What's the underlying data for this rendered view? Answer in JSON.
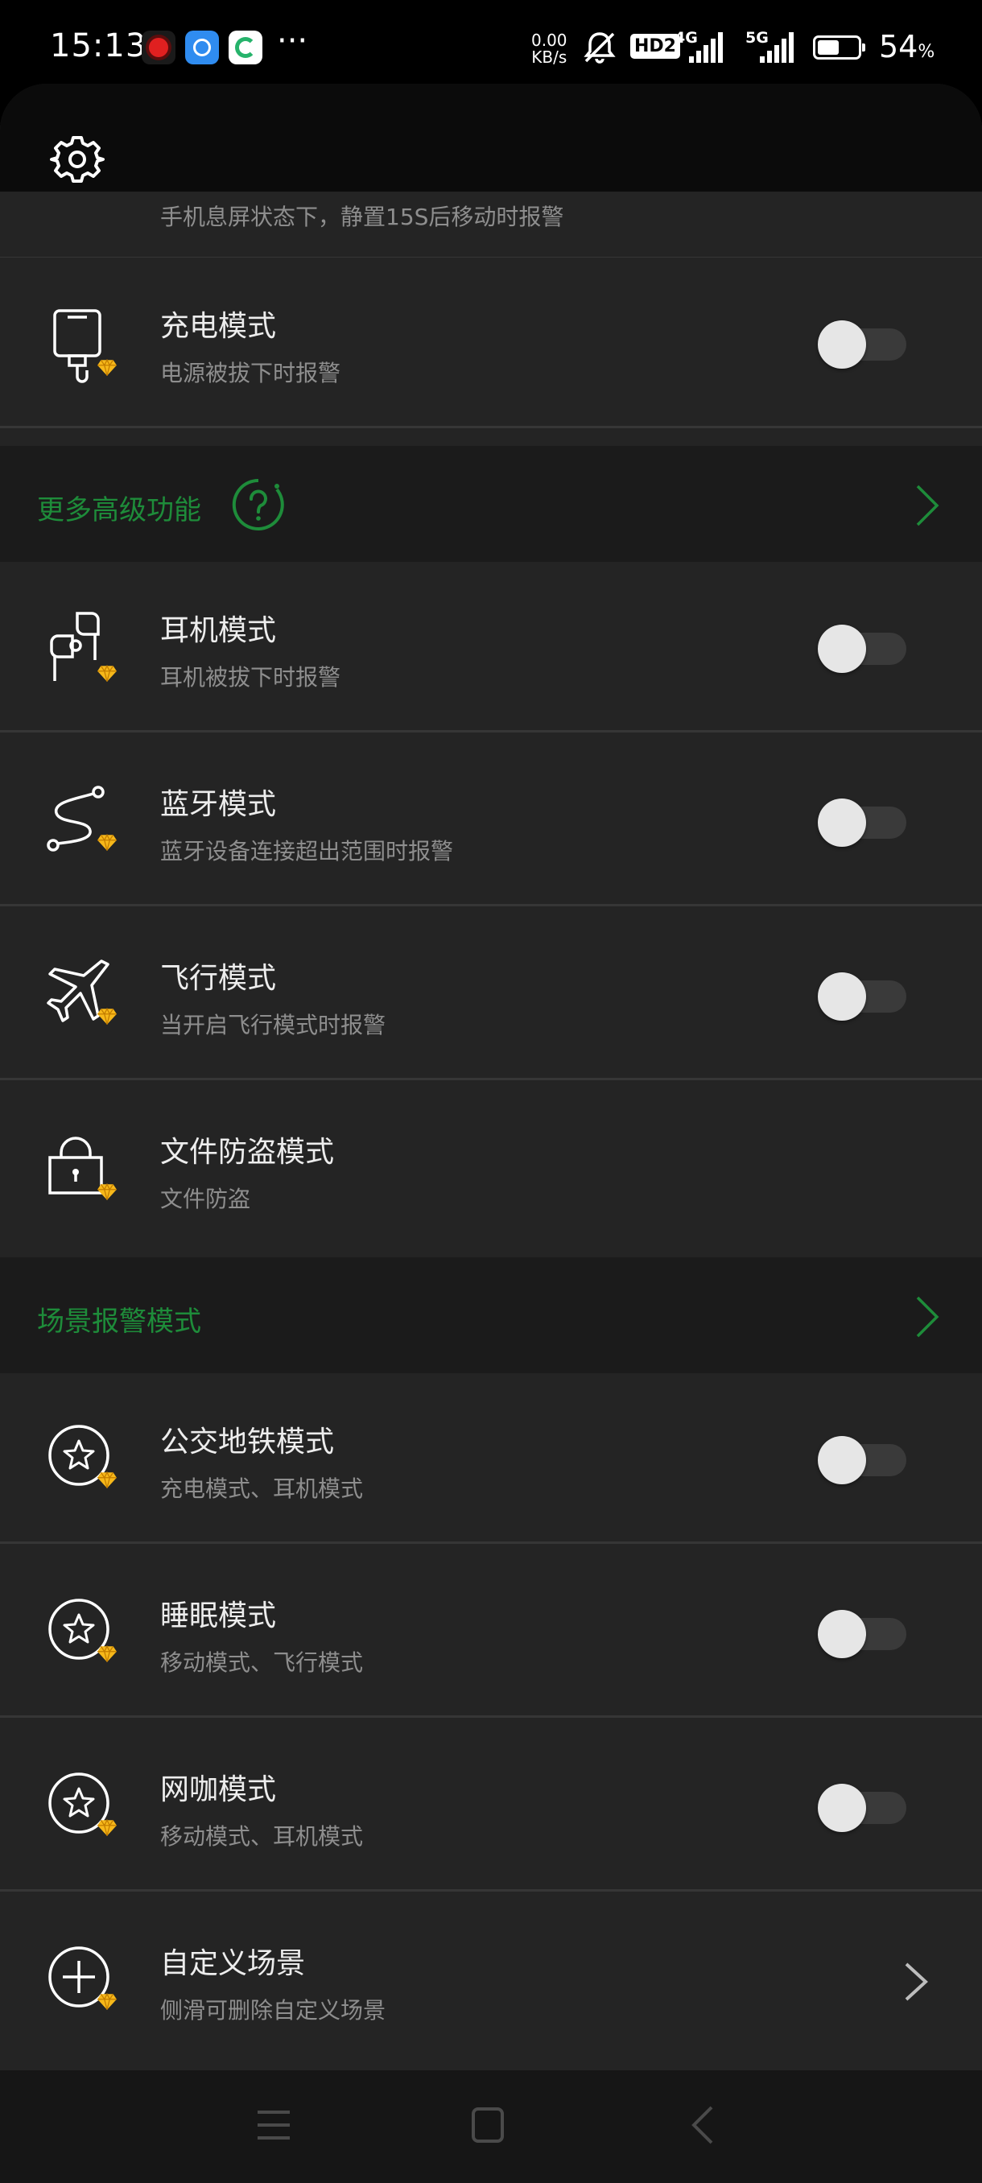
{
  "status_bar": {
    "time": "15:13",
    "speed_value": "0.00",
    "speed_unit": "KB/s",
    "hd_badge": "HD2",
    "net1": "4G",
    "net2": "5G",
    "battery_percent": 54,
    "battery_text": "54",
    "battery_unit": "%",
    "more_dots": "···"
  },
  "colors": {
    "accent_green": "#1e8c3a",
    "background": "#242424",
    "section_background": "#1b1b1b"
  },
  "top_partial": {
    "subtitle": "手机息屏状态下，静置15S后移动时报警",
    "toggle_on": false
  },
  "rows_basic": [
    {
      "title": "充电模式",
      "subtitle": "电源被拔下时报警",
      "icon": "charger-icon",
      "toggle_on": false
    }
  ],
  "section_advanced": {
    "label": "更多高级功能",
    "help_icon": "help-icon"
  },
  "rows_advanced": [
    {
      "title": "耳机模式",
      "subtitle": "耳机被拔下时报警",
      "icon": "earphones-icon",
      "toggle_on": false
    },
    {
      "title": "蓝牙模式",
      "subtitle": "蓝牙设备连接超出范围时报警",
      "icon": "bluetooth-route-icon",
      "toggle_on": false
    },
    {
      "title": "飞行模式",
      "subtitle": "当开启飞行模式时报警",
      "icon": "airplane-icon",
      "toggle_on": false
    },
    {
      "title": "文件防盗模式",
      "subtitle": "文件防盗",
      "icon": "lock-icon"
    }
  ],
  "section_scene": {
    "label": "场景报警模式"
  },
  "rows_scene": [
    {
      "title": "公交地铁模式",
      "subtitle": "充电模式、耳机模式",
      "icon": "star-icon",
      "toggle_on": false
    },
    {
      "title": "睡眠模式",
      "subtitle": "移动模式、飞行模式",
      "icon": "star-icon",
      "toggle_on": false
    },
    {
      "title": "网咖模式",
      "subtitle": "移动模式、耳机模式",
      "icon": "star-icon",
      "toggle_on": false
    },
    {
      "title": "自定义场景",
      "subtitle": "侧滑可删除自定义场景",
      "icon": "add-circle-icon"
    }
  ]
}
